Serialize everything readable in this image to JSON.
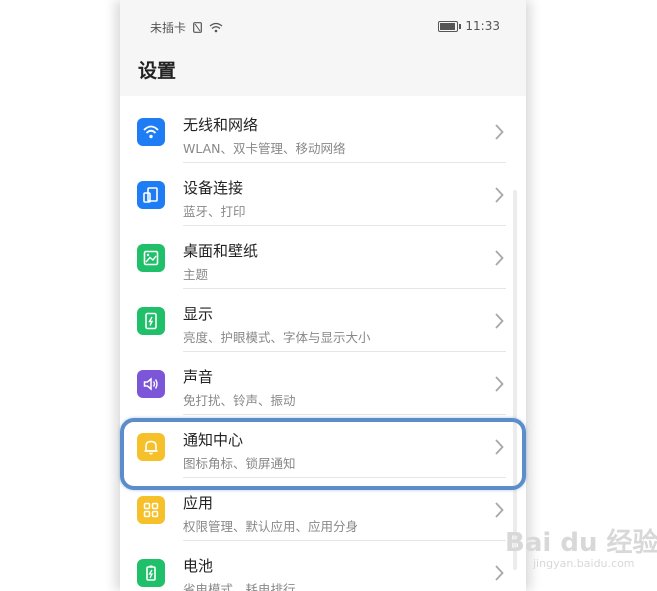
{
  "status_bar": {
    "carrier": "未插卡",
    "time": "11:33",
    "battery_level": 0.85
  },
  "page": {
    "title": "设置"
  },
  "items": [
    {
      "label": "无线和网络",
      "sub": "WLAN、双卡管理、移动网络",
      "icon": "wifi-icon",
      "color": "#1e7cf5"
    },
    {
      "label": "设备连接",
      "sub": "蓝牙、打印",
      "icon": "device-link-icon",
      "color": "#1e7cf5"
    },
    {
      "label": "桌面和壁纸",
      "sub": "主题",
      "icon": "wallpaper-icon",
      "color": "#20c06b"
    },
    {
      "label": "显示",
      "sub": "亮度、护眼模式、字体与显示大小",
      "icon": "display-icon",
      "color": "#20c06b"
    },
    {
      "label": "声音",
      "sub": "免打扰、铃声、振动",
      "icon": "sound-icon",
      "color": "#7b56d8"
    },
    {
      "label": "通知中心",
      "sub": "图标角标、锁屏通知",
      "icon": "bell-icon",
      "color": "#f6c02a"
    },
    {
      "label": "应用",
      "sub": "权限管理、默认应用、应用分身",
      "icon": "apps-icon",
      "color": "#f6c02a"
    },
    {
      "label": "电池",
      "sub": "省电模式、耗电排行",
      "icon": "battery-icon",
      "color": "#20c06b"
    }
  ],
  "watermark": {
    "brand": "Bai du 经验",
    "url": "jingyan.baidu.com"
  }
}
